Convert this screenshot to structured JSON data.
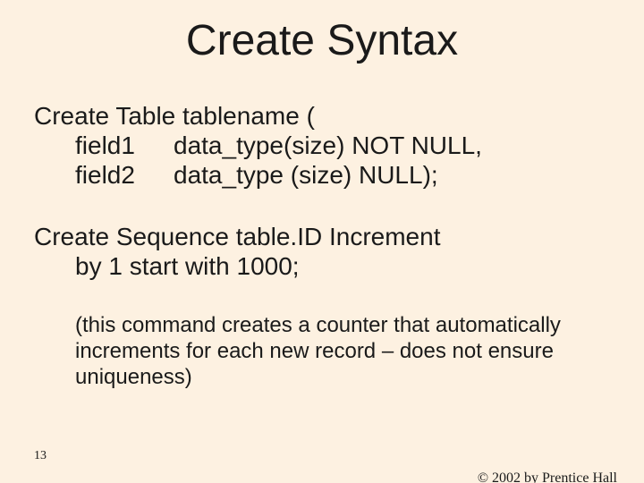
{
  "title": "Create Syntax",
  "block1": {
    "line1": "Create Table tablename (",
    "f1": "field1",
    "d1": "data_type(size) NOT NULL,",
    "f2": "field2",
    "d2": "data_type (size) NULL);"
  },
  "block2": {
    "line1": "Create Sequence table.ID Increment",
    "line2": "by 1 start with 1000;"
  },
  "note": "(this command creates a counter that automatically increments for each new record – does not ensure uniqueness)",
  "page_number": "13",
  "copyright": "© 2002 by Prentice Hall"
}
